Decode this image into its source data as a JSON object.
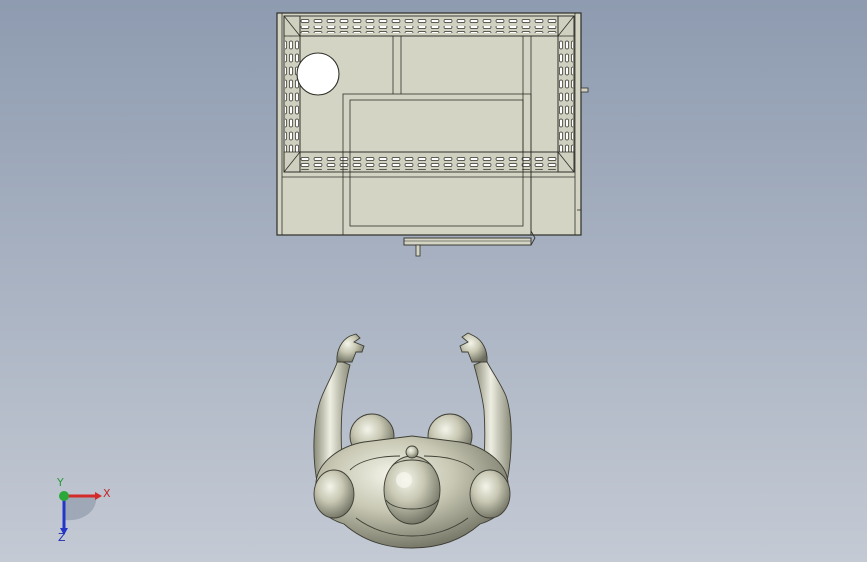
{
  "viewport": {
    "background_top": "#8e9bb0",
    "background_bottom": "#c4cad4"
  },
  "model": {
    "enclosure_fill": "#d4d4c4",
    "edge_color": "#2e2e28",
    "mannequin_fill": "#c8c8b4"
  },
  "triad": {
    "x_label": "X",
    "y_label": "Y",
    "z_label": "Z",
    "x_color": "#d42a2a",
    "y_color": "#2aa83a",
    "z_color": "#2436c8"
  }
}
